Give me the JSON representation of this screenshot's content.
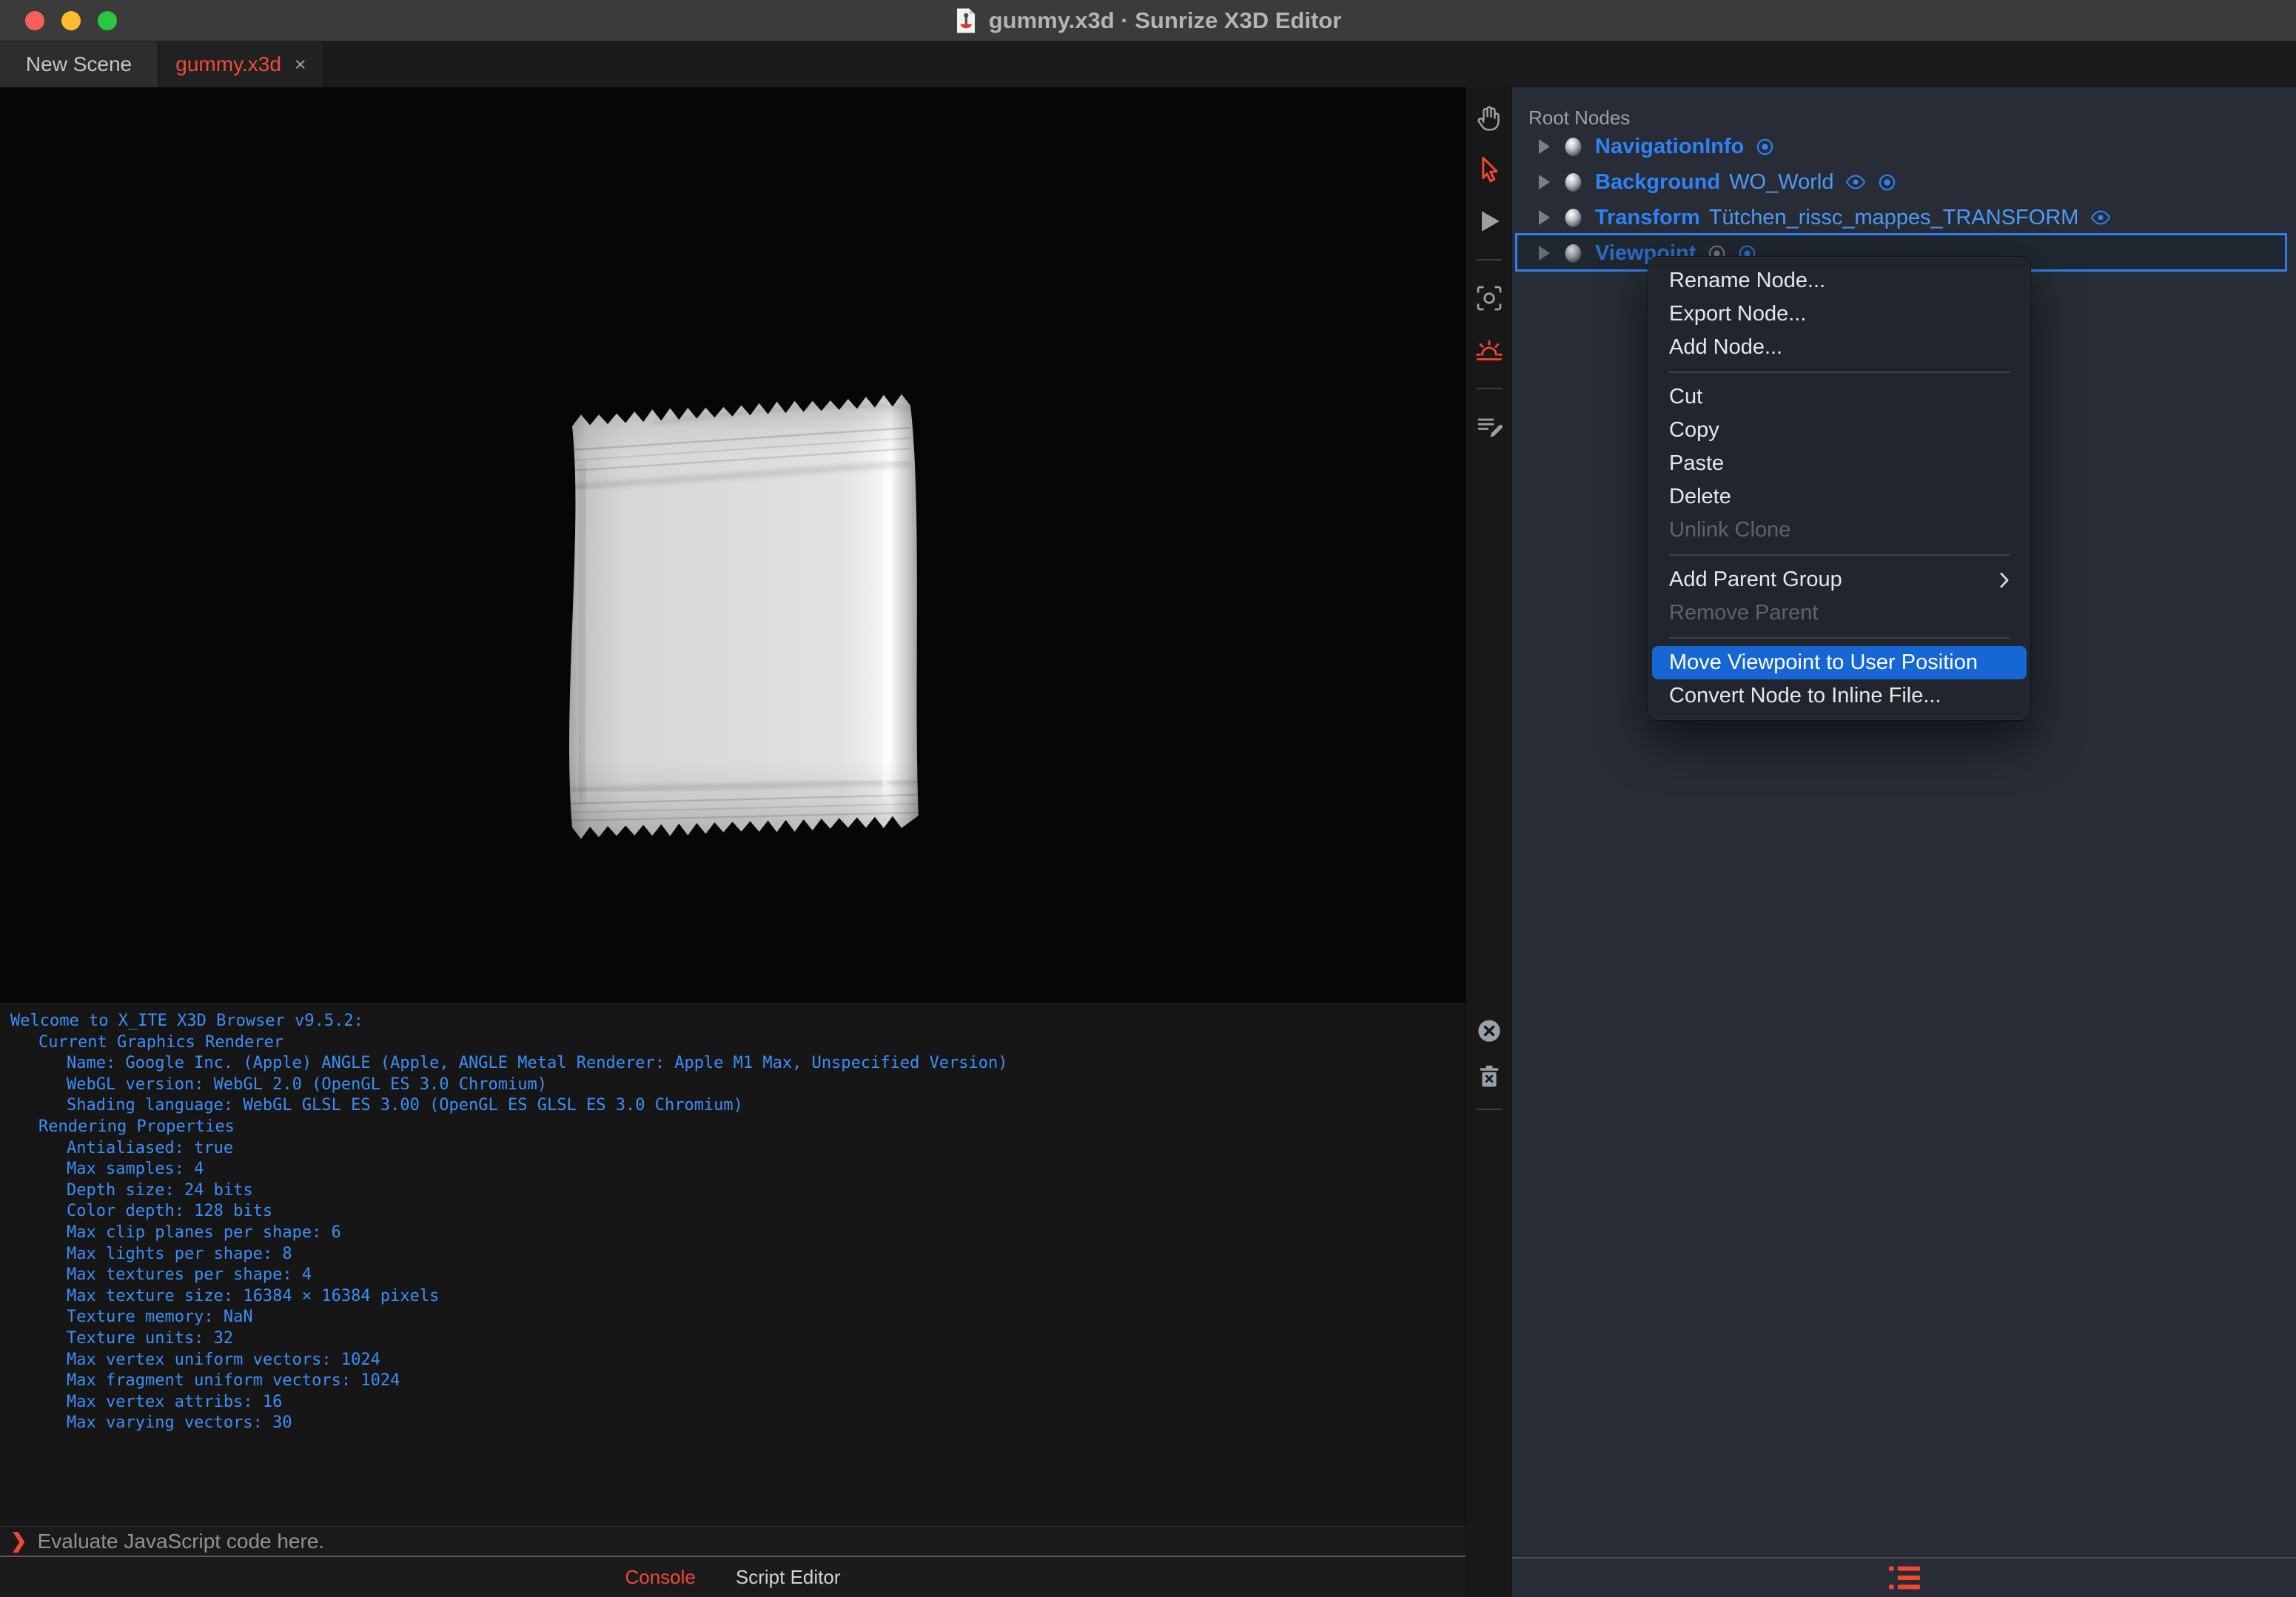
{
  "window": {
    "title": "gummy.x3d · Sunrize X3D Editor",
    "traffic_lights": [
      {
        "name": "close",
        "color": "#ff5f57"
      },
      {
        "name": "minimize",
        "color": "#febc2e"
      },
      {
        "name": "zoom",
        "color": "#28c840"
      }
    ]
  },
  "tabs": [
    {
      "label": "New Scene",
      "active": false
    },
    {
      "label": "gummy.x3d",
      "active": true,
      "close_glyph": "×"
    }
  ],
  "toolbar": {
    "items": [
      {
        "icon": "hand-tool-icon",
        "active": false
      },
      {
        "icon": "select-arrow-icon",
        "active": true
      },
      {
        "icon": "play-icon",
        "active": false
      },
      {
        "separator": true
      },
      {
        "icon": "center-viewpoint-icon",
        "active": false
      },
      {
        "icon": "sunrise-light-icon",
        "active": true
      },
      {
        "separator": true
      },
      {
        "icon": "script-editor-icon",
        "active": false
      }
    ]
  },
  "console": {
    "lines": [
      {
        "indent": 0,
        "text": "Welcome to X_ITE X3D Browser v9.5.2:"
      },
      {
        "indent": 1,
        "text": "Current Graphics Renderer"
      },
      {
        "indent": 2,
        "text": "Name: Google Inc. (Apple) ANGLE (Apple, ANGLE Metal Renderer: Apple M1 Max, Unspecified Version)"
      },
      {
        "indent": 2,
        "text": "WebGL version: WebGL 2.0 (OpenGL ES 3.0 Chromium)"
      },
      {
        "indent": 2,
        "text": "Shading language: WebGL GLSL ES 3.00 (OpenGL ES GLSL ES 3.0 Chromium)"
      },
      {
        "indent": 1,
        "text": "Rendering Properties"
      },
      {
        "indent": 2,
        "text": "Antialiased: true"
      },
      {
        "indent": 2,
        "text": "Max samples: 4"
      },
      {
        "indent": 2,
        "text": "Depth size: 24 bits"
      },
      {
        "indent": 2,
        "text": "Color depth: 128 bits"
      },
      {
        "indent": 2,
        "text": "Max clip planes per shape: 6"
      },
      {
        "indent": 2,
        "text": "Max lights per shape: 8"
      },
      {
        "indent": 2,
        "text": "Max textures per shape: 4"
      },
      {
        "indent": 2,
        "text": "Max texture size: 16384 × 16384 pixels"
      },
      {
        "indent": 2,
        "text": "Texture memory: NaN"
      },
      {
        "indent": 2,
        "text": "Texture units: 32"
      },
      {
        "indent": 2,
        "text": "Max vertex uniform vectors: 1024"
      },
      {
        "indent": 2,
        "text": "Max fragment uniform vectors: 1024"
      },
      {
        "indent": 2,
        "text": "Max vertex attribs: 16"
      },
      {
        "indent": 2,
        "text": "Max varying vectors: 30"
      }
    ],
    "buttons": [
      {
        "icon": "close-circle-icon"
      },
      {
        "icon": "trash-icon"
      }
    ],
    "input": {
      "prompt": "❯",
      "placeholder": "Evaluate JavaScript code here."
    },
    "tabs": [
      {
        "label": "Console",
        "active": true
      },
      {
        "label": "Script Editor",
        "active": false
      }
    ]
  },
  "outline": {
    "title": "Root Nodes",
    "nodes": [
      {
        "type": "NavigationInfo",
        "name": "",
        "selected": false,
        "icons": [
          {
            "icon": "bind-target-icon",
            "color": "#2f82f6"
          }
        ]
      },
      {
        "type": "Background",
        "name": "WO_World",
        "selected": false,
        "icons": [
          {
            "icon": "eye-icon",
            "color": "#2f82f6"
          },
          {
            "icon": "bind-target-icon",
            "color": "#2f82f6"
          }
        ]
      },
      {
        "type": "Transform",
        "name": "Tütchen_rissc_mappes_TRANSFORM",
        "selected": false,
        "icons": [
          {
            "icon": "eye-icon",
            "color": "#2f82f6"
          }
        ]
      },
      {
        "type": "Viewpoint",
        "name": "",
        "selected": true,
        "icons": [
          {
            "icon": "bind-target-icon",
            "color": "#888e96"
          },
          {
            "icon": "bind-target-icon",
            "color": "#2f82f6"
          }
        ]
      }
    ],
    "footer_icon": "outline-list-icon"
  },
  "context_menu": {
    "items": [
      {
        "label": "Rename Node...",
        "type": "item"
      },
      {
        "label": "Export Node...",
        "type": "item"
      },
      {
        "label": "Add Node...",
        "type": "item"
      },
      {
        "type": "separator"
      },
      {
        "label": "Cut",
        "type": "item"
      },
      {
        "label": "Copy",
        "type": "item"
      },
      {
        "label": "Paste",
        "type": "item"
      },
      {
        "label": "Delete",
        "type": "item"
      },
      {
        "label": "Unlink Clone",
        "type": "item",
        "disabled": true
      },
      {
        "type": "separator"
      },
      {
        "label": "Add Parent Group",
        "type": "item",
        "submenu": true
      },
      {
        "label": "Remove Parent",
        "type": "item",
        "disabled": true
      },
      {
        "type": "separator"
      },
      {
        "label": "Move Viewpoint to User Position",
        "type": "item",
        "highlighted": true
      },
      {
        "label": "Convert Node to Inline File...",
        "type": "item"
      }
    ]
  },
  "colors": {
    "accent_red": "#f4472e",
    "accent_blue": "#2f82f6",
    "menu_highlight": "#1666d4",
    "console_text": "#3e8ef7",
    "panel_bg": "#272c36",
    "selection_outline": "#2f80ed"
  }
}
